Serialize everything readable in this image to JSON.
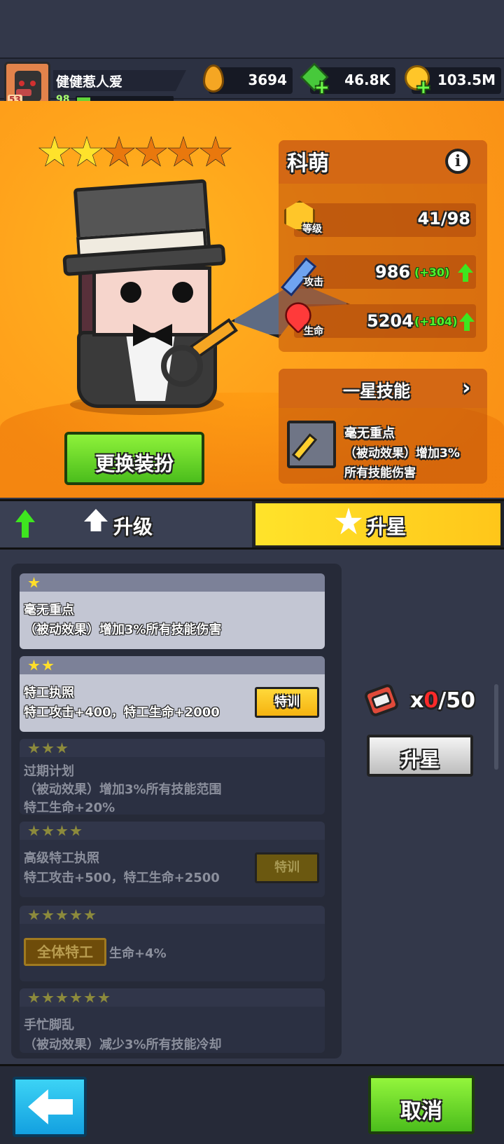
{
  "player": {
    "name": "健健惹人爱",
    "level": "98",
    "avatar_badge": "53",
    "xp_fraction": 0.14
  },
  "resources": [
    {
      "icon": "drop-icon",
      "value": "3694"
    },
    {
      "icon": "gem-icon",
      "value": "46.8K"
    },
    {
      "icon": "coin-icon",
      "value": "103.5M"
    }
  ],
  "hero": {
    "stars_total": 6,
    "stars_filled": 2,
    "name": "科萌",
    "info_glyph": "i",
    "stats": [
      {
        "icon": "level-badge-icon",
        "label": "等级",
        "value": "41/98",
        "bonus": ""
      },
      {
        "icon": "sword-icon",
        "label": "攻击",
        "value": "986",
        "bonus": "(+30)"
      },
      {
        "icon": "heart-icon",
        "label": "生命",
        "value": "5204",
        "bonus": "(+104)"
      }
    ],
    "change_outfit_label": "更换装扮"
  },
  "skill": {
    "title": "一星技能",
    "name": "毫无重点",
    "desc_line1": "（被动效果）增加3%",
    "desc_line2": "所有技能伤害"
  },
  "tabs": {
    "upgrade_label": "升级",
    "star_label": "升星",
    "active": "star"
  },
  "star_list": [
    {
      "stars": 1,
      "unlocked": true,
      "lines": [
        "毫无重点",
        "（被动效果）增加3%所有技能伤害"
      ],
      "button": ""
    },
    {
      "stars": 2,
      "unlocked": true,
      "lines": [
        "特工执照",
        "特工攻击+400，特工生命+2000"
      ],
      "button": "特训"
    },
    {
      "stars": 3,
      "unlocked": false,
      "lines": [
        "过期计划",
        "（被动效果）增加3%所有技能范围",
        "特工生命+20%"
      ],
      "button": ""
    },
    {
      "stars": 4,
      "unlocked": false,
      "lines": [
        "高级特工执照",
        "特工攻击+500，特工生命+2500"
      ],
      "button": "特训"
    },
    {
      "stars": 5,
      "unlocked": false,
      "lines": [
        "生命+4%"
      ],
      "tag": "全体特工",
      "button": ""
    },
    {
      "stars": 6,
      "unlocked": false,
      "lines": [
        "手忙脚乱",
        "（被动效果）减少3%所有技能冷却"
      ],
      "button": ""
    }
  ],
  "fragments": {
    "prefix": "x",
    "have": "0",
    "need": "/50",
    "have_color": "#ff2a2a"
  },
  "buttons": {
    "star_up": "升星",
    "cancel": "取消"
  },
  "colors": {
    "accent_orange": "#ffa21b",
    "accent_green": "#4bbd1c",
    "tab_active": "#ffd21f"
  }
}
